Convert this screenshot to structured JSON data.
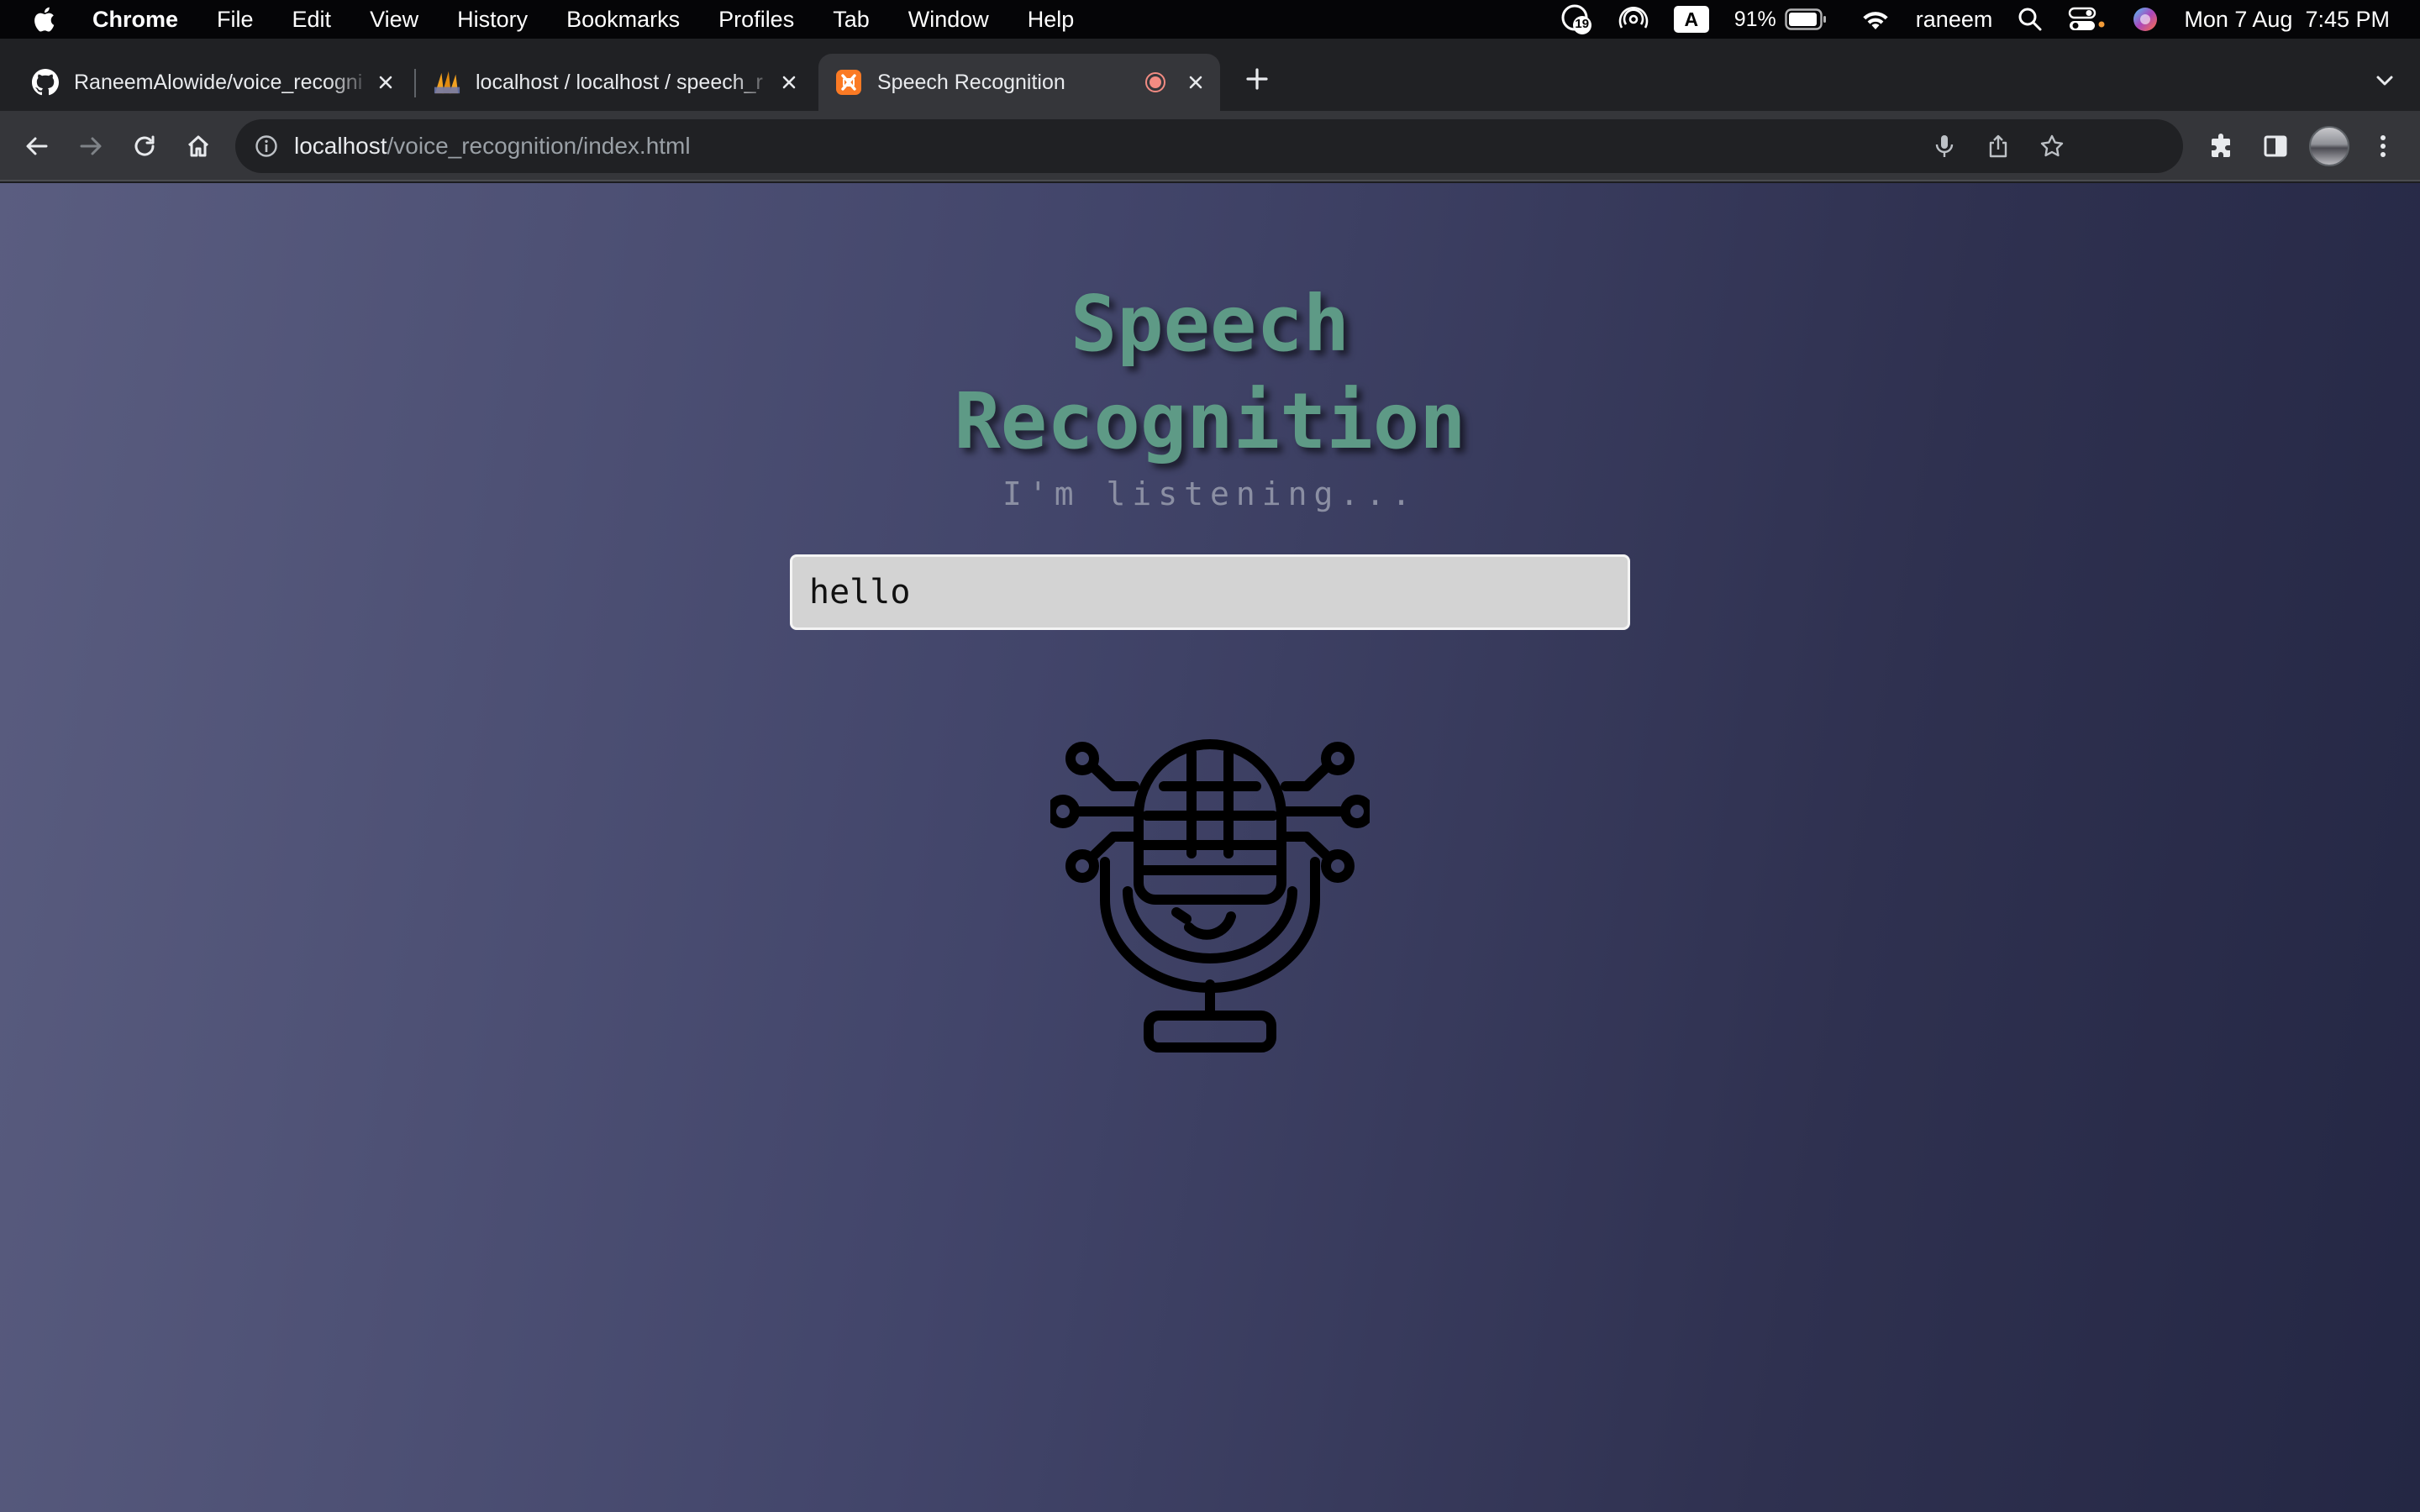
{
  "menubar": {
    "app_name": "Chrome",
    "items": [
      "File",
      "Edit",
      "View",
      "History",
      "Bookmarks",
      "Profiles",
      "Tab",
      "Window",
      "Help"
    ],
    "status": {
      "notification_badge": "19",
      "keyboard_input": "A",
      "battery_percent": "91%",
      "user": "raneem",
      "datetime": "Mon 7 Aug  7:45 PM"
    }
  },
  "tabs": [
    {
      "title": "RaneemAlowide/voice_recogni",
      "icon": "github-icon",
      "active": false
    },
    {
      "title": "localhost / localhost / speech_r",
      "icon": "phpmyadmin-icon",
      "active": false
    },
    {
      "title": "Speech Recognition",
      "icon": "xampp-icon",
      "active": true,
      "recording": true
    }
  ],
  "toolbar": {
    "url_host": "localhost",
    "url_path": "/voice_recognition/index.html"
  },
  "page": {
    "title_line1": "Speech",
    "title_line2": "Recognition",
    "subtitle": "I'm listening...",
    "transcript_value": "hello"
  },
  "colors": {
    "title": "#5e9a86",
    "subtitle": "#8b8fa3",
    "background_start": "#5a5d80",
    "background_end": "#242744"
  }
}
